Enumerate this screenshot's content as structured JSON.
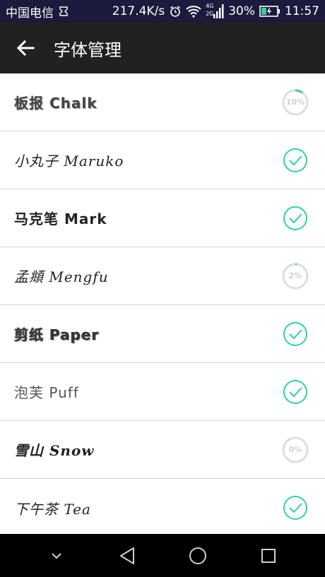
{
  "status_bar": {
    "carrier": "中国电信",
    "speed": "217.4K/s",
    "network_label_top": "4G",
    "network_label_bottom": "2G",
    "battery": "30%",
    "time": "11:57"
  },
  "app_bar": {
    "title": "字体管理",
    "back_icon": "arrow-left-icon"
  },
  "fonts": [
    {
      "name": "板报 Chalk",
      "status": "downloading",
      "progress": 0.1,
      "progress_label": "10%"
    },
    {
      "name": "小丸子 Maruko",
      "status": "installed"
    },
    {
      "name": "马克笔 Mark",
      "status": "installed"
    },
    {
      "name": "孟頫 Mengfu",
      "status": "downloading",
      "progress": 0.02,
      "progress_label": "2%"
    },
    {
      "name": "剪纸 Paper",
      "status": "installed"
    },
    {
      "name": "泡芙 Puff",
      "status": "installed"
    },
    {
      "name": "雪山 Snow",
      "status": "downloading",
      "progress": 0.0,
      "progress_label": "0%"
    },
    {
      "name": "下午茶 Tea",
      "status": "installed"
    }
  ],
  "colors": {
    "accent": "#2fd49a",
    "track": "#dedede",
    "app_bar": "#212121",
    "status_bar": "#1c1b3d"
  },
  "nav_bar": {
    "icons": [
      "chevron-down-icon",
      "back-triangle-icon",
      "home-circle-icon",
      "recents-square-icon"
    ]
  }
}
